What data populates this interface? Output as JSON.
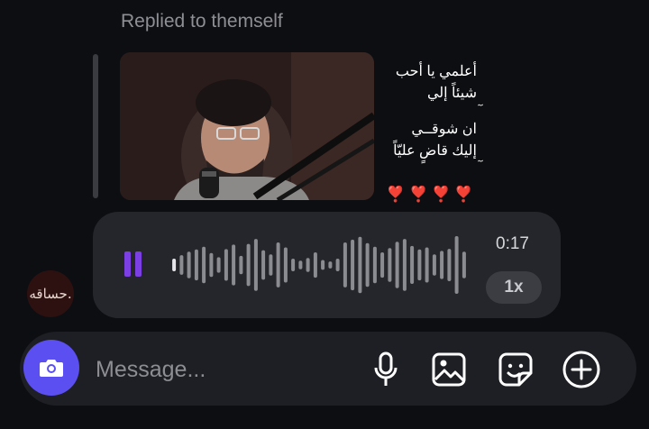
{
  "thread": {
    "replied_label": "Replied to themself"
  },
  "quoted_message": {
    "lines": [
      "أعلمي يا أحب",
      "شيئاً إلي",
      "ٓ",
      "ان شوقــي",
      "إليك قاضٍ عليّاً",
      "ٓ"
    ],
    "hearts": "❣️❣️❣️❣️",
    "thumbnail_icon": "video-thumbnail-image"
  },
  "voice_message": {
    "duration": "0:17",
    "speed": "1x",
    "state_icon": "pause-icon",
    "accent_color": "#7b3fe4",
    "waveform_levels": [
      0.18,
      0.28,
      0.38,
      0.44,
      0.52,
      0.34,
      0.22,
      0.45,
      0.58,
      0.26,
      0.6,
      0.74,
      0.42,
      0.3,
      0.64,
      0.5,
      0.18,
      0.12,
      0.2,
      0.36,
      0.14,
      0.1,
      0.18,
      0.64,
      0.72,
      0.8,
      0.62,
      0.52,
      0.36,
      0.48,
      0.66,
      0.74,
      0.54,
      0.44,
      0.5,
      0.3,
      0.4,
      0.46,
      0.82,
      0.38
    ]
  },
  "sender": {
    "avatar_text": "حساقه."
  },
  "composer": {
    "placeholder": "Message...",
    "camera_icon": "camera-icon",
    "mic_icon": "microphone-icon",
    "gallery_icon": "image-icon",
    "sticker_icon": "sticker-icon",
    "add_icon": "plus-circle-icon",
    "camera_color": "#5b4ff1"
  }
}
